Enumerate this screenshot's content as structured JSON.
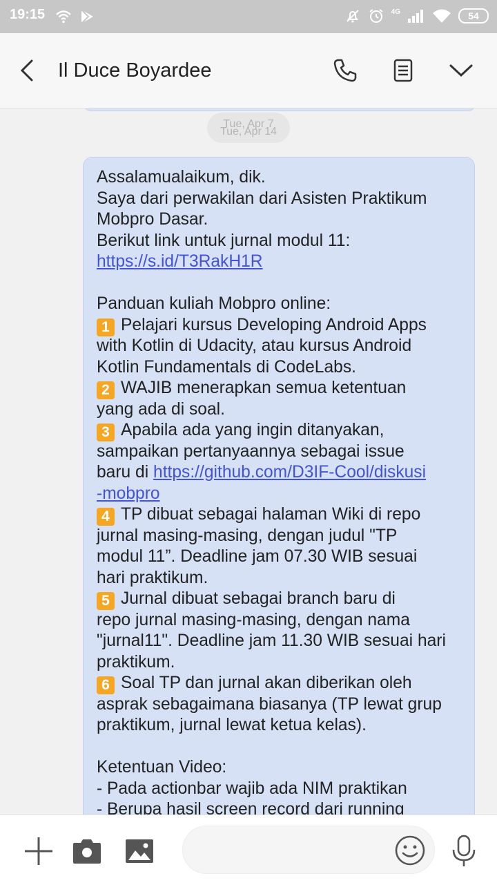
{
  "status_bar": {
    "time": "19:15",
    "battery": "54",
    "network": "4G"
  },
  "header": {
    "contact_name": "Il Duce Boyardee"
  },
  "date_separator": {
    "current": "Tue, Apr 7",
    "overlapped": "Tue, Apr 14"
  },
  "message": {
    "l1": "Assalamualaikum, dik.",
    "l2": "Saya dari perwakilan dari Asisten Praktikum",
    "l3": "Mobpro Dasar.",
    "l4": "Berikut link untuk jurnal modul 11:",
    "link1": "https://s.id/T3RakH1R",
    "l6": "Panduan kuliah Mobpro online:",
    "k1": "1",
    "l7": "Pelajari kursus Developing Android Apps",
    "l8": "with Kotlin di Udacity, atau kursus Android",
    "l9": "Kotlin Fundamentals di CodeLabs.",
    "k2": "2",
    "l10": "WAJIB menerapkan semua ketentuan",
    "l11": "yang ada di soal.",
    "k3": "3",
    "l12": "Apabila ada yang ingin ditanyakan,",
    "l13": "sampaikan pertanyaannya sebagai issue",
    "l14_prefix": "baru di ",
    "link2_part1": "https://github.com/D3IF-Cool/diskusi",
    "link2_part2": "-mobpro",
    "k4": "4",
    "l16": "TP dibuat sebagai halaman Wiki di repo",
    "l17": "jurnal masing-masing, dengan judul \"TP",
    "l18": "modul 11”. Deadline jam 07.30 WIB sesuai",
    "l19": "hari praktikum.",
    "k5": "5",
    "l20": "Jurnal dibuat sebagai branch baru di",
    "l21": "repo jurnal masing-masing, dengan nama",
    "l22": "\"jurnal11\". Deadline jam 11.30 WIB sesuai hari",
    "l23": "praktikum.",
    "k6": "6",
    "l24": "Soal TP dan jurnal akan diberikan oleh",
    "l25": "asprak sebagaimana biasanya (TP lewat grup",
    "l26": "praktikum, jurnal lewat ketua kelas).",
    "l27": "Ketentuan Video:",
    "l28": "- Pada actionbar wajib ada NIM praktikan",
    "l29": "- Berupa hasil screen record dari running"
  },
  "input": {
    "placeholder": ""
  },
  "icons": {
    "back": "chevron-left-icon",
    "call": "phone-icon",
    "details": "document-icon",
    "more": "chevron-down-icon",
    "add": "plus-icon",
    "camera": "camera-icon",
    "gallery": "image-icon",
    "emoji": "smiley-icon",
    "voice": "microphone-icon"
  },
  "colors": {
    "bubble": "#d6e1f5",
    "link": "#4353d8",
    "keycap": "#f5a623",
    "status_bar": "#c7c7c7"
  }
}
